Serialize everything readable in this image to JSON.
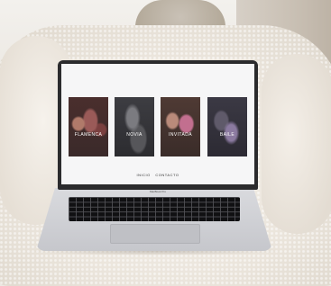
{
  "gallery": {
    "tiles": [
      {
        "label": "FLAMENCA"
      },
      {
        "label": "NOVIA"
      },
      {
        "label": "INVITADA"
      },
      {
        "label": "BAILE"
      }
    ]
  },
  "footer": {
    "left_link": "INICIO",
    "right_link": "CONTACTO"
  },
  "laptop": {
    "brand_text": "MacBook Pro"
  }
}
